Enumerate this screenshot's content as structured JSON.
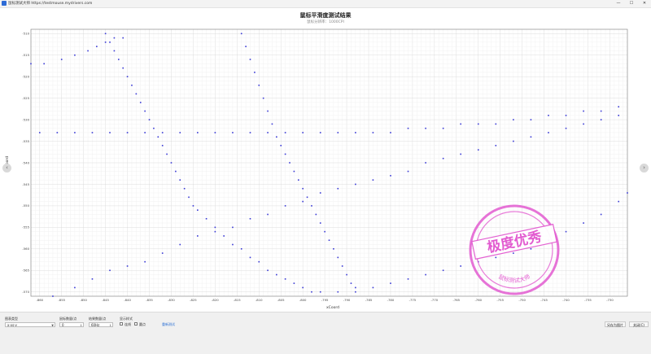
{
  "window": {
    "title": "鼠标测试大师 https://testmouse.mydrivers.com",
    "controls": {
      "minimize": "—",
      "maximize": "☐",
      "close": "✕"
    }
  },
  "colors": {
    "series": "#3a3ad6",
    "link": "#2a6fd4",
    "stamp": "#e25bd0"
  },
  "chart_data": {
    "type": "scatter",
    "title": "鼠标平滑度测试结果",
    "subtitle": "鼠标分辨率：1000CPI",
    "xlabel": "xCoord",
    "ylabel": "yCoord",
    "xlim": [
      -862,
      -726
    ],
    "ylim": [
      -571,
      -509
    ],
    "x_ticks": [
      -860,
      -855,
      -850,
      -845,
      -840,
      -835,
      -830,
      -825,
      -820,
      -815,
      -810,
      -805,
      -800,
      -795,
      -790,
      -785,
      -780,
      -775,
      -770,
      -765,
      -760,
      -755,
      -750,
      -745,
      -740,
      -735,
      -730
    ],
    "y_ticks": [
      -510,
      -515,
      -520,
      -525,
      -530,
      -535,
      -540,
      -545,
      -550,
      -555,
      -560,
      -565,
      -570
    ],
    "grid": true,
    "series": [
      {
        "points": [
          [
            -862,
            -517
          ],
          [
            -859,
            -517
          ],
          [
            -855,
            -516
          ],
          [
            -852,
            -515
          ],
          [
            -849,
            -514
          ],
          [
            -847,
            -513
          ],
          [
            -845,
            -512
          ],
          [
            -843,
            -511
          ],
          [
            -841,
            -511
          ]
        ]
      },
      {
        "points": [
          [
            -845,
            -510
          ],
          [
            -844,
            -512
          ],
          [
            -843,
            -514
          ],
          [
            -842,
            -516
          ],
          [
            -841,
            -518
          ],
          [
            -840,
            -520
          ],
          [
            -839,
            -522
          ],
          [
            -838,
            -524
          ],
          [
            -837,
            -526
          ],
          [
            -836,
            -528
          ],
          [
            -835,
            -530
          ],
          [
            -834,
            -532
          ],
          [
            -833,
            -534
          ],
          [
            -832,
            -536
          ],
          [
            -831,
            -538
          ],
          [
            -830,
            -540
          ],
          [
            -829,
            -542
          ],
          [
            -828,
            -544
          ],
          [
            -827,
            -546
          ],
          [
            -826,
            -548
          ],
          [
            -825,
            -550
          ],
          [
            -824,
            -551
          ],
          [
            -822,
            -553
          ],
          [
            -820,
            -555
          ],
          [
            -818,
            -557
          ],
          [
            -816,
            -559
          ],
          [
            -814,
            -560
          ],
          [
            -812,
            -562
          ],
          [
            -810,
            -563
          ],
          [
            -808,
            -565
          ],
          [
            -806,
            -566
          ],
          [
            -804,
            -567
          ],
          [
            -802,
            -568
          ],
          [
            -800,
            -569
          ],
          [
            -798,
            -570
          ]
        ]
      },
      {
        "points": [
          [
            -814,
            -510
          ],
          [
            -813,
            -513
          ],
          [
            -812,
            -516
          ],
          [
            -811,
            -519
          ],
          [
            -810,
            -522
          ],
          [
            -809,
            -525
          ],
          [
            -808,
            -528
          ],
          [
            -807,
            -531
          ],
          [
            -806,
            -534
          ],
          [
            -805,
            -536
          ],
          [
            -804,
            -538
          ],
          [
            -803,
            -540
          ],
          [
            -802,
            -542
          ],
          [
            -801,
            -544
          ],
          [
            -800,
            -546
          ],
          [
            -799,
            -548
          ],
          [
            -798,
            -550
          ],
          [
            -797,
            -552
          ],
          [
            -796,
            -554
          ],
          [
            -795,
            -556
          ],
          [
            -794,
            -558
          ],
          [
            -793,
            -560
          ],
          [
            -792,
            -562
          ],
          [
            -791,
            -564
          ],
          [
            -790,
            -566
          ],
          [
            -789,
            -568
          ],
          [
            -788,
            -570
          ]
        ]
      },
      {
        "points": [
          [
            -860,
            -533
          ],
          [
            -856,
            -533
          ],
          [
            -852,
            -533
          ],
          [
            -848,
            -533
          ],
          [
            -844,
            -533
          ],
          [
            -840,
            -533
          ],
          [
            -836,
            -533
          ],
          [
            -832,
            -533
          ],
          [
            -828,
            -533
          ],
          [
            -824,
            -533
          ],
          [
            -820,
            -533
          ],
          [
            -816,
            -533
          ],
          [
            -812,
            -533
          ],
          [
            -808,
            -533
          ],
          [
            -804,
            -533
          ],
          [
            -800,
            -533
          ],
          [
            -796,
            -533
          ],
          [
            -792,
            -533
          ],
          [
            -788,
            -533
          ],
          [
            -784,
            -533
          ],
          [
            -780,
            -533
          ],
          [
            -776,
            -532
          ],
          [
            -772,
            -532
          ],
          [
            -768,
            -532
          ],
          [
            -764,
            -531
          ],
          [
            -760,
            -531
          ],
          [
            -756,
            -531
          ],
          [
            -752,
            -530
          ],
          [
            -748,
            -530
          ],
          [
            -744,
            -529
          ],
          [
            -740,
            -529
          ],
          [
            -736,
            -528
          ],
          [
            -732,
            -528
          ],
          [
            -728,
            -527
          ]
        ]
      },
      {
        "points": [
          [
            -857,
            -571
          ],
          [
            -852,
            -569
          ],
          [
            -848,
            -567
          ],
          [
            -844,
            -565
          ],
          [
            -840,
            -564
          ],
          [
            -836,
            -563
          ],
          [
            -832,
            -561
          ],
          [
            -828,
            -559
          ],
          [
            -824,
            -557
          ],
          [
            -820,
            -556
          ],
          [
            -816,
            -555
          ],
          [
            -812,
            -553
          ],
          [
            -808,
            -552
          ],
          [
            -804,
            -550
          ],
          [
            -800,
            -549
          ],
          [
            -796,
            -547
          ],
          [
            -792,
            -546
          ],
          [
            -788,
            -545
          ],
          [
            -784,
            -544
          ],
          [
            -780,
            -543
          ],
          [
            -776,
            -542
          ],
          [
            -772,
            -540
          ],
          [
            -768,
            -539
          ],
          [
            -764,
            -538
          ],
          [
            -760,
            -537
          ],
          [
            -756,
            -536
          ],
          [
            -752,
            -535
          ],
          [
            -748,
            -534
          ],
          [
            -744,
            -533
          ],
          [
            -740,
            -532
          ],
          [
            -736,
            -531
          ],
          [
            -732,
            -530
          ],
          [
            -728,
            -529
          ]
        ]
      },
      {
        "points": [
          [
            -796,
            -570
          ],
          [
            -792,
            -570
          ],
          [
            -788,
            -569
          ],
          [
            -784,
            -569
          ],
          [
            -780,
            -568
          ],
          [
            -776,
            -567
          ],
          [
            -772,
            -566
          ],
          [
            -768,
            -565
          ],
          [
            -764,
            -564
          ],
          [
            -760,
            -563
          ],
          [
            -756,
            -562
          ],
          [
            -752,
            -561
          ],
          [
            -748,
            -560
          ],
          [
            -744,
            -558
          ],
          [
            -740,
            -556
          ],
          [
            -736,
            -554
          ],
          [
            -732,
            -552
          ],
          [
            -728,
            -549
          ],
          [
            -726,
            -547
          ]
        ]
      }
    ]
  },
  "controls": {
    "chart_type_label": "图表类型",
    "chart_type_value": "x-vs-y",
    "sample_label": "鼠标数量/点",
    "sample_value": "0",
    "rate_label": "结果数量/点",
    "rate_value": "60Hz",
    "display_label": "显示样式",
    "connect_label": "连线",
    "dots_label": "圆点",
    "link_text": "重新测试",
    "save_button": "另存为图片",
    "close_button": "关闭(C)"
  },
  "stamp": {
    "text": "极度优秀",
    "ring_text": "鼠标测试大师"
  }
}
